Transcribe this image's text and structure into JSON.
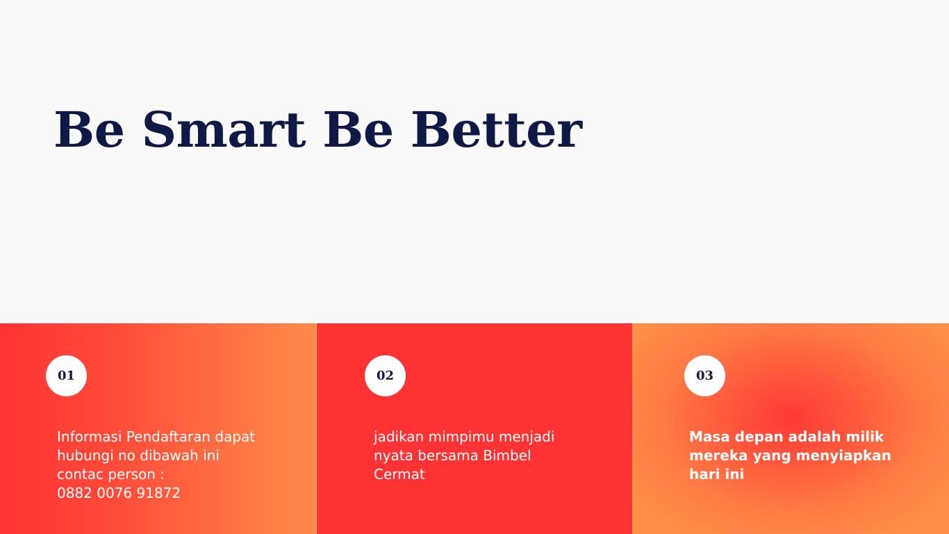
{
  "hero": {
    "title": "Be Smart Be Better"
  },
  "panels": [
    {
      "number": "01",
      "text": "Informasi Pendaftaran dapat\nhubungi no dibawah ini\ncontac person :\n0882 0076 91872",
      "bold": false
    },
    {
      "number": "02",
      "text": "jadikan mimpimu menjadi\nnyata bersama Bimbel\nCermat",
      "bold": false
    },
    {
      "number": "03",
      "text": "Masa depan adalah milik\nmereka yang menyiapkan\nhari ini",
      "bold": true
    }
  ],
  "colors": {
    "title": "#0e1a45",
    "background": "#f9f9f9",
    "panel_red": "#ff3334",
    "panel_orange": "#ff8b48"
  }
}
